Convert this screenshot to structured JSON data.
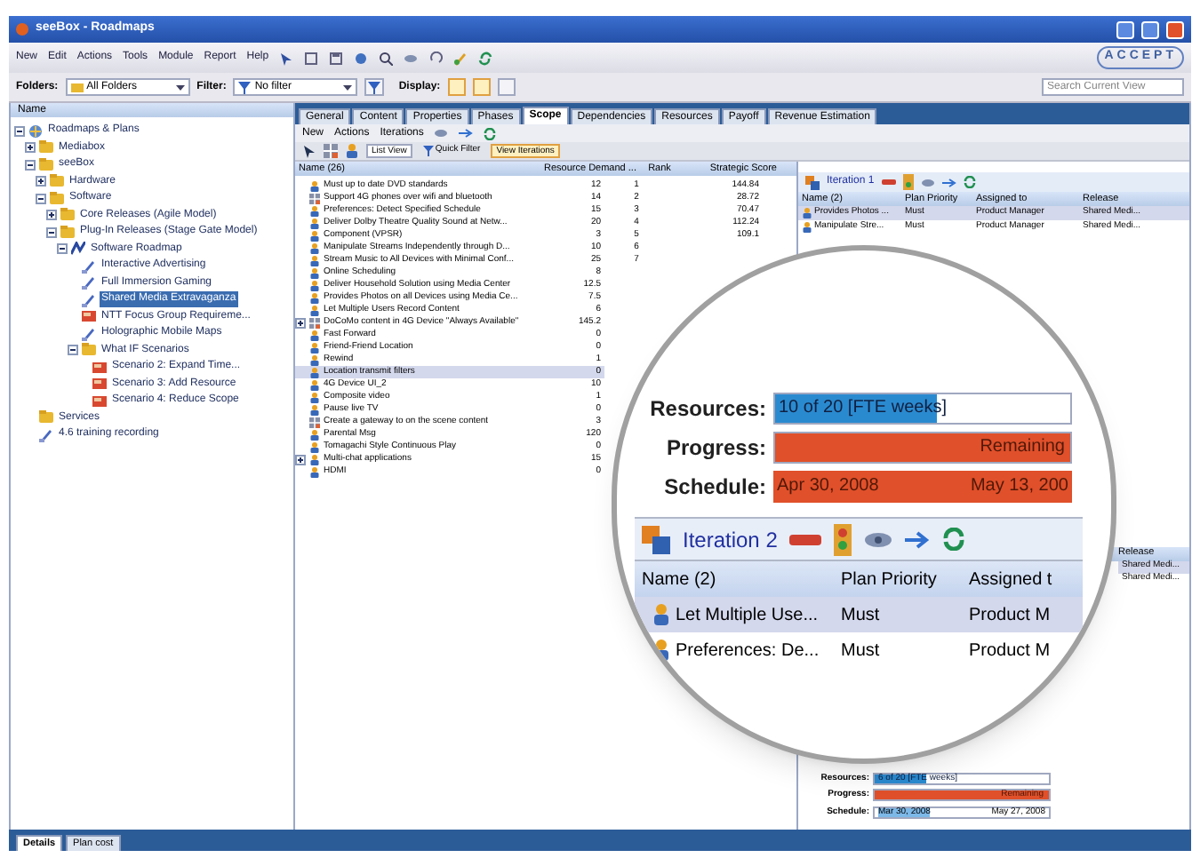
{
  "window": {
    "title": "seeBox - Roadmaps"
  },
  "menu": [
    "New",
    "Edit",
    "Actions",
    "Tools",
    "Module",
    "Report",
    "Help"
  ],
  "logo": "ACCEPT",
  "filter_bar": {
    "folders_label": "Folders:",
    "folders_value": "All Folders",
    "filter_label": "Filter:",
    "filter_value": "No filter",
    "display_label": "Display:",
    "search_placeholder": "Search Current View"
  },
  "tree": {
    "header": "Name",
    "items": [
      {
        "label": "Roadmaps & Plans",
        "kind": "root",
        "expanded": true,
        "selected": false,
        "children": [
          {
            "label": "Mediabox",
            "kind": "folder",
            "expanded": false,
            "selected": false
          },
          {
            "label": "seeBox",
            "kind": "folder",
            "expanded": true,
            "selected": false,
            "children": [
              {
                "label": "Hardware",
                "kind": "folder",
                "expanded": false,
                "selected": false
              },
              {
                "label": "Software",
                "kind": "folder",
                "expanded": true,
                "selected": false,
                "children": [
                  {
                    "label": "Core Releases (Agile Model)",
                    "kind": "folder",
                    "expanded": false,
                    "selected": false
                  },
                  {
                    "label": "Plug-In Releases (Stage Gate Model)",
                    "kind": "folder",
                    "expanded": true,
                    "selected": false,
                    "children": [
                      {
                        "label": "Software Roadmap",
                        "kind": "roadmap",
                        "expanded": true,
                        "selected": false,
                        "children": [
                          {
                            "label": "Interactive Advertising",
                            "kind": "plan",
                            "selected": false
                          },
                          {
                            "label": "Full Immersion Gaming",
                            "kind": "plan",
                            "selected": false
                          },
                          {
                            "label": "Shared Media Extravaganza",
                            "kind": "plan",
                            "selected": true
                          },
                          {
                            "label": "NTT Focus Group Requireme...",
                            "kind": "scenario",
                            "selected": false
                          },
                          {
                            "label": "Holographic Mobile Maps",
                            "kind": "plan",
                            "selected": false
                          },
                          {
                            "label": "What IF Scenarios",
                            "kind": "folder",
                            "expanded": true,
                            "selected": false,
                            "children": [
                              {
                                "label": "Scenario 2: Expand Time...",
                                "kind": "scenario",
                                "selected": false
                              },
                              {
                                "label": "Scenario 3: Add Resource",
                                "kind": "scenario",
                                "selected": false
                              },
                              {
                                "label": "Scenario 4: Reduce Scope",
                                "kind": "scenario",
                                "selected": false
                              }
                            ]
                          }
                        ]
                      }
                    ]
                  }
                ]
              }
            ]
          },
          {
            "label": "Services",
            "kind": "folder",
            "selected": false
          },
          {
            "label": "4.6 training recording",
            "kind": "plan",
            "selected": false
          }
        ]
      }
    ]
  },
  "tabs": [
    {
      "label": "General",
      "selected": false
    },
    {
      "label": "Content",
      "selected": false
    },
    {
      "label": "Properties",
      "selected": false
    },
    {
      "label": "Phases",
      "selected": false
    },
    {
      "label": "Scope",
      "selected": true
    },
    {
      "label": "Dependencies",
      "selected": false
    },
    {
      "label": "Resources",
      "selected": false
    },
    {
      "label": "Payoff",
      "selected": false
    },
    {
      "label": "Revenue Estimation",
      "selected": false
    }
  ],
  "scope_menu": [
    "New",
    "Actions",
    "Iterations"
  ],
  "scope_toolbar": {
    "list_view": "List View",
    "quick_filter": "Quick Filter",
    "view_iterations": "View Iterations"
  },
  "requirements": {
    "columns": [
      "Name (26)",
      "Resource Demand ...",
      "Rank",
      "Strategic Score"
    ],
    "rows": [
      {
        "kind": "person",
        "name": "Must up to date DVD standards",
        "demand": "12",
        "rank": "1",
        "score": "144.84",
        "selected": false
      },
      {
        "kind": "group",
        "name": "Support 4G phones over wifi and bluetooth",
        "demand": "14",
        "rank": "2",
        "score": "28.72",
        "selected": false
      },
      {
        "kind": "person",
        "name": "Preferences: Detect Specified Schedule",
        "demand": "15",
        "rank": "3",
        "score": "70.47",
        "selected": false
      },
      {
        "kind": "person",
        "name": "Deliver Dolby Theatre Quality Sound at Netw...",
        "demand": "20",
        "rank": "4",
        "score": "112.24",
        "selected": false
      },
      {
        "kind": "person",
        "name": "Component (VPSR)",
        "demand": "3",
        "rank": "5",
        "score": "109.1",
        "selected": false
      },
      {
        "kind": "person",
        "name": "Manipulate Streams Independently through D...",
        "demand": "10",
        "rank": "6",
        "selected": false
      },
      {
        "kind": "person",
        "name": "Stream Music to All Devices with Minimal Conf...",
        "demand": "25",
        "rank": "7",
        "selected": false
      },
      {
        "kind": "person",
        "name": "Online Scheduling",
        "demand": "8",
        "selected": false
      },
      {
        "kind": "person",
        "name": "Deliver Household Solution using Media Center",
        "demand": "12.5",
        "selected": false
      },
      {
        "kind": "person",
        "name": "Provides Photos on all Devices using Media Ce...",
        "demand": "7.5",
        "selected": false
      },
      {
        "kind": "person",
        "name": "Let Multiple Users Record Content",
        "demand": "6",
        "selected": false
      },
      {
        "kind": "group",
        "name": "DoCoMo content in 4G Device \"Always Available\"",
        "demand": "145.2",
        "expanded": false,
        "selected": false
      },
      {
        "kind": "person",
        "name": "Fast Forward",
        "demand": "0",
        "selected": false
      },
      {
        "kind": "person",
        "name": "Friend-Friend Location",
        "demand": "0",
        "selected": false
      },
      {
        "kind": "person",
        "name": "Rewind",
        "demand": "1",
        "selected": false
      },
      {
        "kind": "person",
        "name": "Location transmit filters",
        "demand": "0",
        "selected": true
      },
      {
        "kind": "person",
        "name": "4G Device UI_2",
        "demand": "10",
        "selected": false
      },
      {
        "kind": "person",
        "name": "Composite video",
        "demand": "1",
        "selected": false
      },
      {
        "kind": "person",
        "name": "Pause live TV",
        "demand": "0",
        "selected": false
      },
      {
        "kind": "group",
        "name": "Create a gateway to on the scene content",
        "demand": "3",
        "selected": false
      },
      {
        "kind": "person",
        "name": "Parental Msg",
        "demand": "120",
        "selected": false
      },
      {
        "kind": "person",
        "name": "Tomagachi Style Continuous Play",
        "demand": "0",
        "selected": false
      },
      {
        "kind": "person",
        "name": "Multi-chat applications",
        "demand": "15",
        "expanded": false,
        "selected": false
      },
      {
        "kind": "person",
        "name": "HDMI",
        "demand": "0",
        "selected": false
      }
    ]
  },
  "iteration_panel": {
    "title": "Iteration 1",
    "columns": [
      "Name (2)",
      "Plan Priority",
      "Assigned to",
      "Release"
    ],
    "rows": [
      {
        "cells": [
          "Provides Photos ...",
          "Must",
          "Product Manager",
          "Shared Medi..."
        ],
        "selected": true
      },
      {
        "cells": [
          "Manipulate Stre...",
          "Must",
          "Product Manager",
          "Shared Medi..."
        ],
        "selected": false
      }
    ]
  },
  "release_panel": {
    "column": "Release",
    "rows": [
      {
        "text": "Shared Medi...",
        "selected": true
      },
      {
        "text": "Shared Medi...",
        "selected": false
      }
    ]
  },
  "summary": {
    "resources_label": "Resources:",
    "resources": {
      "text": "6 of 20 [FTE weeks]",
      "level": 0.3
    },
    "progress_label": "Progress:",
    "progress": {
      "text": "Remaining",
      "level": 1
    },
    "schedule_label": "Schedule:",
    "schedule_start": "Mar 30, 2008",
    "schedule_end": "May 27, 2008"
  },
  "bottom_tabs": [
    {
      "label": "Details",
      "selected": true
    },
    {
      "label": "Plan cost",
      "selected": false
    }
  ],
  "magnifier": {
    "resources_label": "Resources:",
    "resources": {
      "text": "10 of 20 [FTE weeks]",
      "level": 0.55
    },
    "progress_label": "Progress:",
    "progress": {
      "text": "Remaining",
      "level": 1
    },
    "schedule_label": "Schedule:",
    "schedule_start": "Apr 30, 2008",
    "schedule_end": "May 13, 200",
    "iteration": "Iteration 2",
    "columns": [
      "Name (2)",
      "Plan Priority",
      "Assigned t"
    ],
    "rows": [
      {
        "cells": [
          "Let Multiple Use...",
          "Must",
          "Product M"
        ],
        "selected": true
      },
      {
        "cells": [
          "Preferences: De...",
          "Must",
          "Product M"
        ],
        "selected": false
      }
    ]
  }
}
